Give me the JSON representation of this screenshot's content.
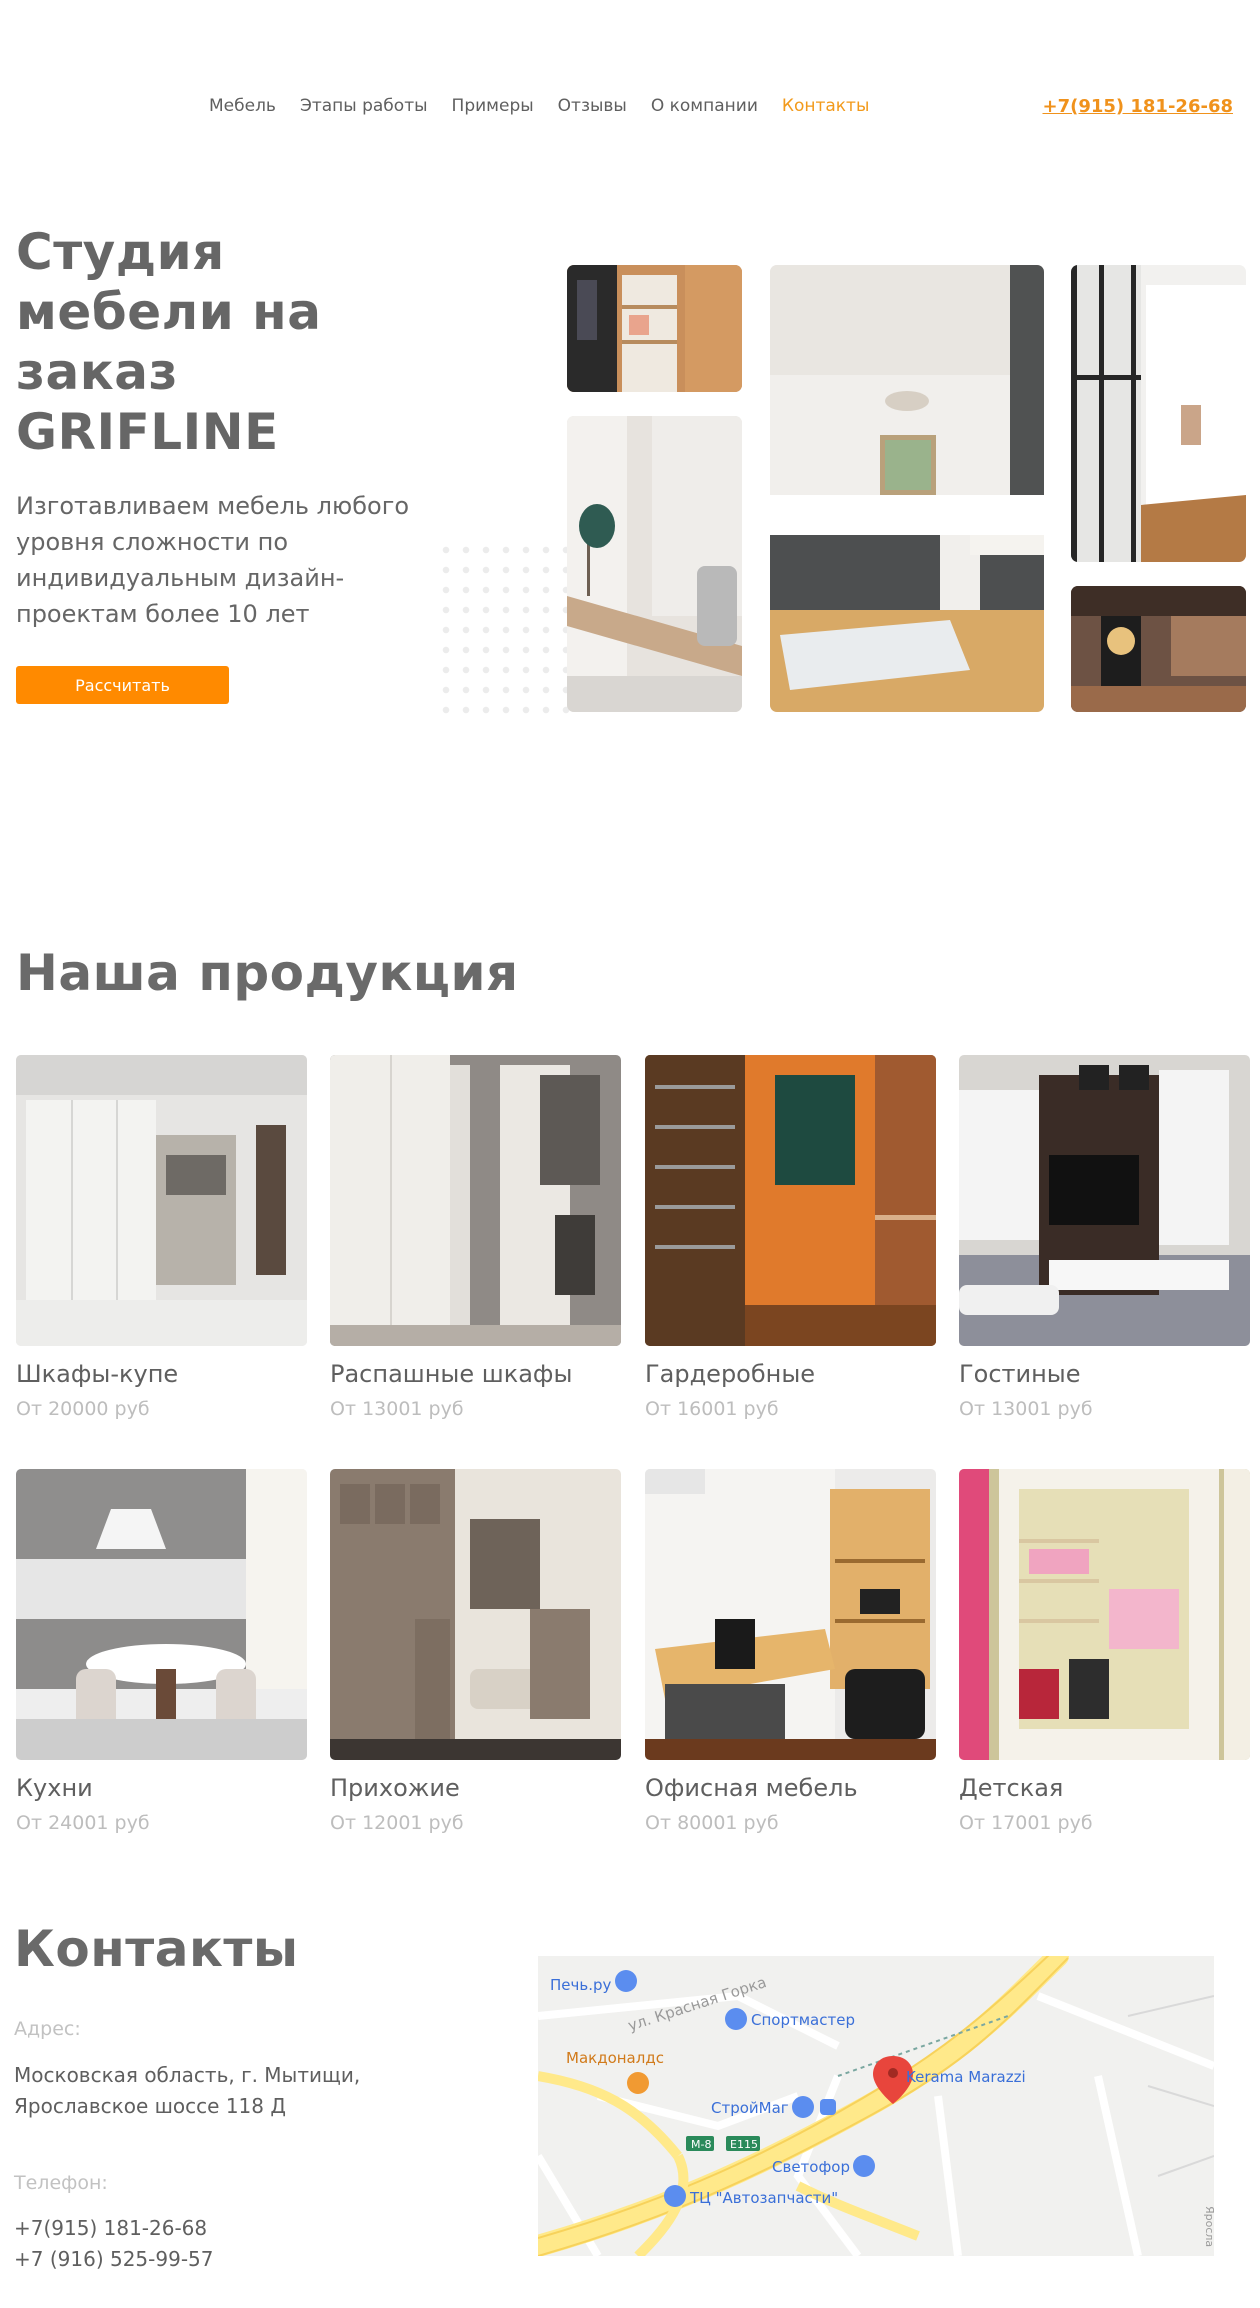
{
  "nav": {
    "items": [
      "Мебель",
      "Этапы работы",
      "Примеры",
      "Отзывы",
      "О компании",
      "Контакты"
    ],
    "active_index": 5
  },
  "header": {
    "phone": "+7(915) 181-26-68"
  },
  "hero": {
    "title": "Студия мебели на заказ GRIFLINE",
    "subtitle": "Изготавливаем мебель любого уровня сложности по индивидуальным дизайн-проектам более 10 лет",
    "cta_label": "Рассчитать"
  },
  "products": {
    "title": "Наша продукция",
    "items": [
      {
        "name": "Шкафы-купе",
        "price": "От 20000 руб"
      },
      {
        "name": "Распашные шкафы",
        "price": "От 13001 руб"
      },
      {
        "name": "Гардеробные",
        "price": "От 16001 руб"
      },
      {
        "name": "Гостиные",
        "price": "От 13001 руб"
      },
      {
        "name": "Кухни",
        "price": "От 24001 руб"
      },
      {
        "name": "Прихожие",
        "price": "От 12001 руб"
      },
      {
        "name": "Офисная мебель",
        "price": "От 80001 руб"
      },
      {
        "name": "Детская",
        "price": "От 17001 руб"
      }
    ]
  },
  "contacts": {
    "title": "Контакты",
    "address_label": "Адрес:",
    "address_value": "Московская область, г. Мытищи, Ярославское шоссе 118 Д",
    "phone_label": "Телефон:",
    "phone_1": "+7(915) 181-26-68",
    "phone_2": "+7 (916) 525-99-57"
  },
  "map": {
    "labels": {
      "pech": "Печь.ру",
      "street": "ул. Красная Горка",
      "sportmaster": "Спортмастер",
      "mcd": "Макдоналдс",
      "kerama": "Kerama Marazzi",
      "stroymag": "СтройМаг",
      "m8": "M-8",
      "e115": "E115",
      "svetofor": "Светофор",
      "avtozap": "ТЦ \"Автозапчасти\"",
      "edge": "Яросла"
    }
  },
  "colors": {
    "accent": "#ff8a00",
    "accent_text": "#f29a1b",
    "text": "#5f5f5f",
    "muted": "#bdbdbd"
  }
}
